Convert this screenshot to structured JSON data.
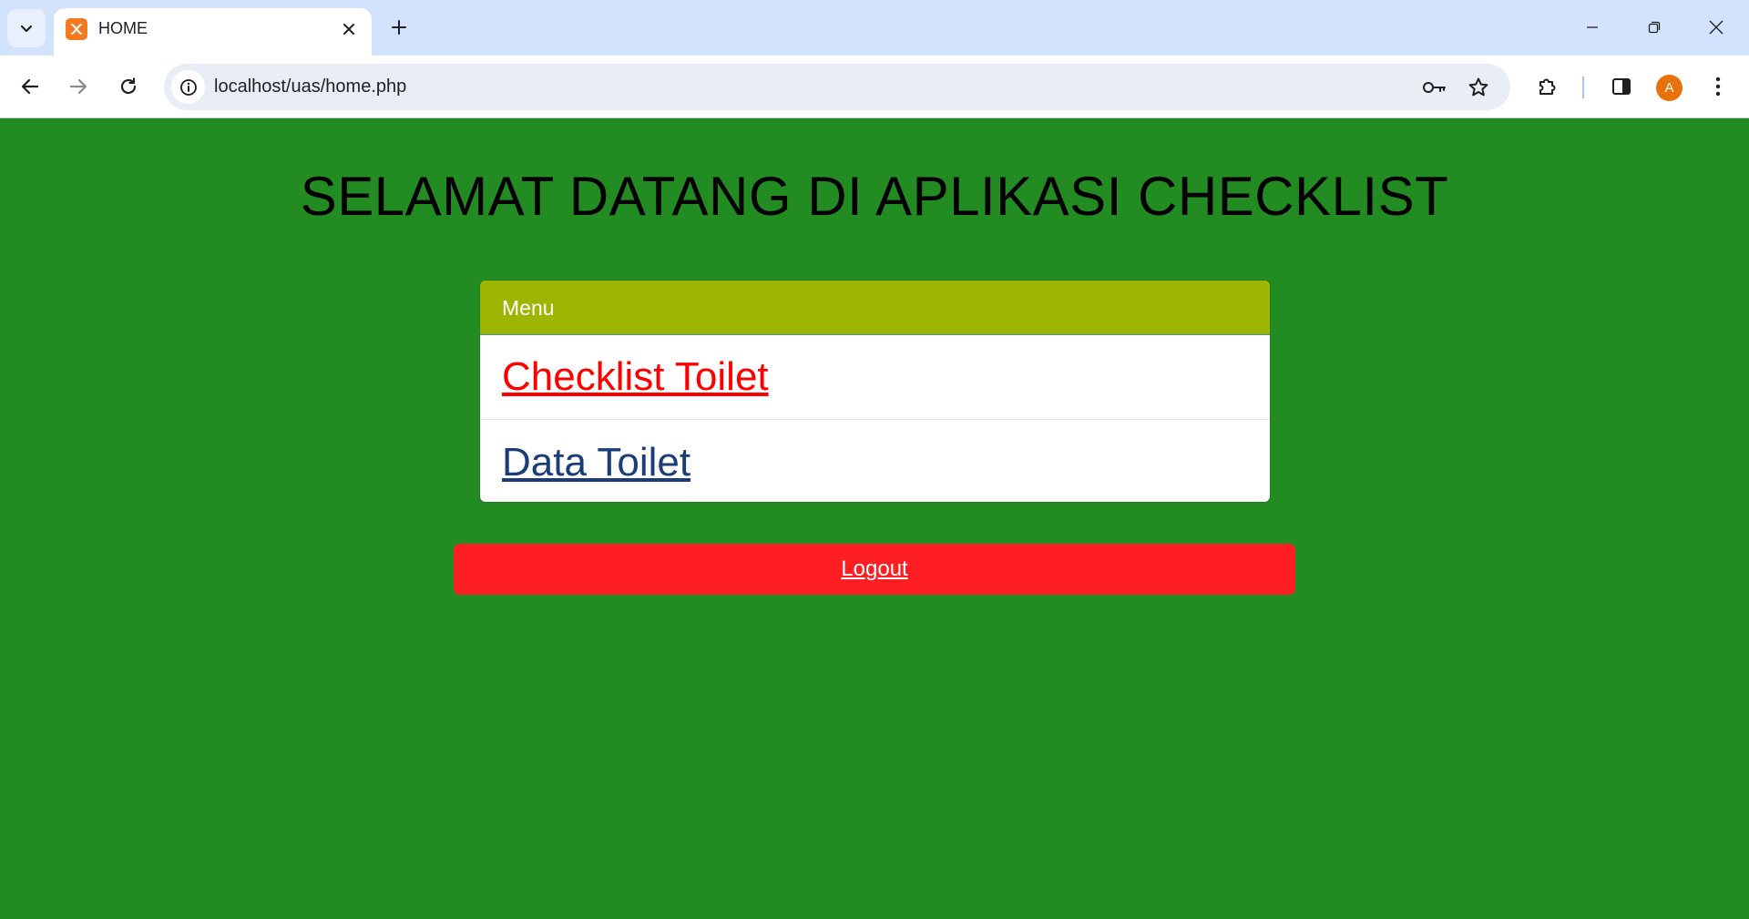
{
  "browser": {
    "tab": {
      "title": "HOME"
    },
    "address_bar": {
      "url": "localhost/uas/home.php"
    },
    "profile": {
      "initial": "A"
    }
  },
  "page": {
    "heading": "SELAMAT DATANG DI APLIKASI CHECKLIST",
    "menu": {
      "header": "Menu",
      "items": [
        {
          "label": "Checklist Toilet"
        },
        {
          "label": "Data Toilet"
        }
      ]
    },
    "logout_label": "Logout"
  },
  "colors": {
    "page_background": "#228b22",
    "menu_header": "#9db603",
    "logout_button": "#ff1e22",
    "link_checklist": "#ff0000",
    "link_data": "#1a3d7a"
  }
}
